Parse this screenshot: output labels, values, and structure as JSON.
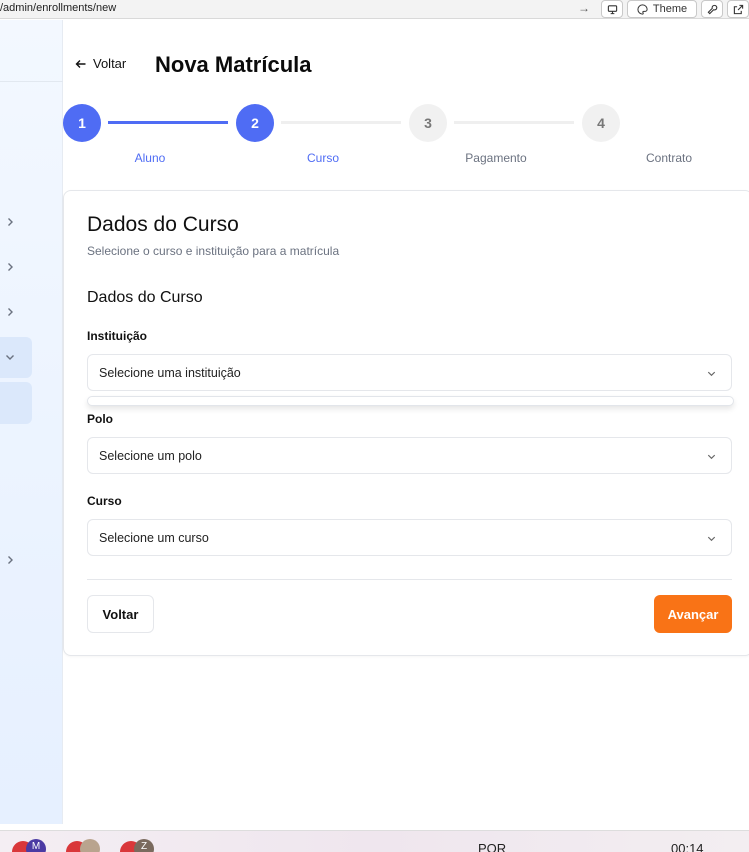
{
  "browser": {
    "url": "/admin/enrollments/new",
    "theme_label": "Theme"
  },
  "header": {
    "back_label": "Voltar",
    "title": "Nova Matrícula"
  },
  "steps": [
    {
      "number": "1",
      "label": "Aluno",
      "state": "active"
    },
    {
      "number": "2",
      "label": "Curso",
      "state": "active"
    },
    {
      "number": "3",
      "label": "Pagamento",
      "state": "inactive"
    },
    {
      "number": "4",
      "label": "Contrato",
      "state": "inactive"
    }
  ],
  "card": {
    "title": "Dados do Curso",
    "subtitle": "Selecione o curso e instituição para a matrícula",
    "section_title": "Dados do Curso",
    "fields": [
      {
        "label": "Instituição",
        "placeholder": "Selecione uma instituição"
      },
      {
        "label": "Polo",
        "placeholder": "Selecione um polo"
      },
      {
        "label": "Curso",
        "placeholder": "Selecione um curso"
      }
    ],
    "back_button": "Voltar",
    "next_button": "Avançar"
  },
  "taskbar": {
    "language": "POR",
    "time": "00:14"
  },
  "colors": {
    "primary": "#4f6cf4",
    "accent": "#f97316"
  }
}
